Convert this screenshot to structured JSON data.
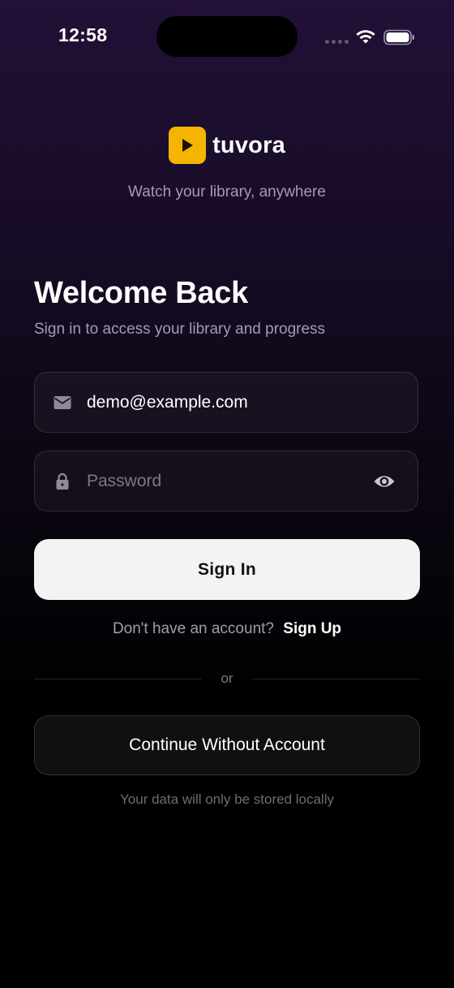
{
  "status_bar": {
    "time": "12:58",
    "icons": [
      "signal-dots-icon",
      "wifi-icon",
      "battery-icon"
    ]
  },
  "brand": {
    "name": "tuvora",
    "tagline": "Watch your library, anywhere",
    "logo_color": "#f5b400",
    "logo_icon": "play-icon"
  },
  "heading": {
    "title": "Welcome Back",
    "subtitle": "Sign in to access your library and progress"
  },
  "form": {
    "email": {
      "icon": "mail-icon",
      "value": "demo@example.com",
      "placeholder": ""
    },
    "password": {
      "icon": "lock-icon",
      "value": "",
      "placeholder": "Password",
      "toggle_icon": "eye-icon"
    },
    "signin_label": "Sign In"
  },
  "signup": {
    "prompt": "Don't have an account?",
    "link_label": "Sign Up"
  },
  "divider": {
    "label": "or"
  },
  "guest": {
    "button_label": "Continue Without Account",
    "note": "Your data will only be stored locally"
  },
  "colors": {
    "background_top": "#221037",
    "background_bottom": "#000000",
    "accent": "#f5b400",
    "primary_button": "#f3f3f3",
    "muted_text": "#a29db0"
  }
}
